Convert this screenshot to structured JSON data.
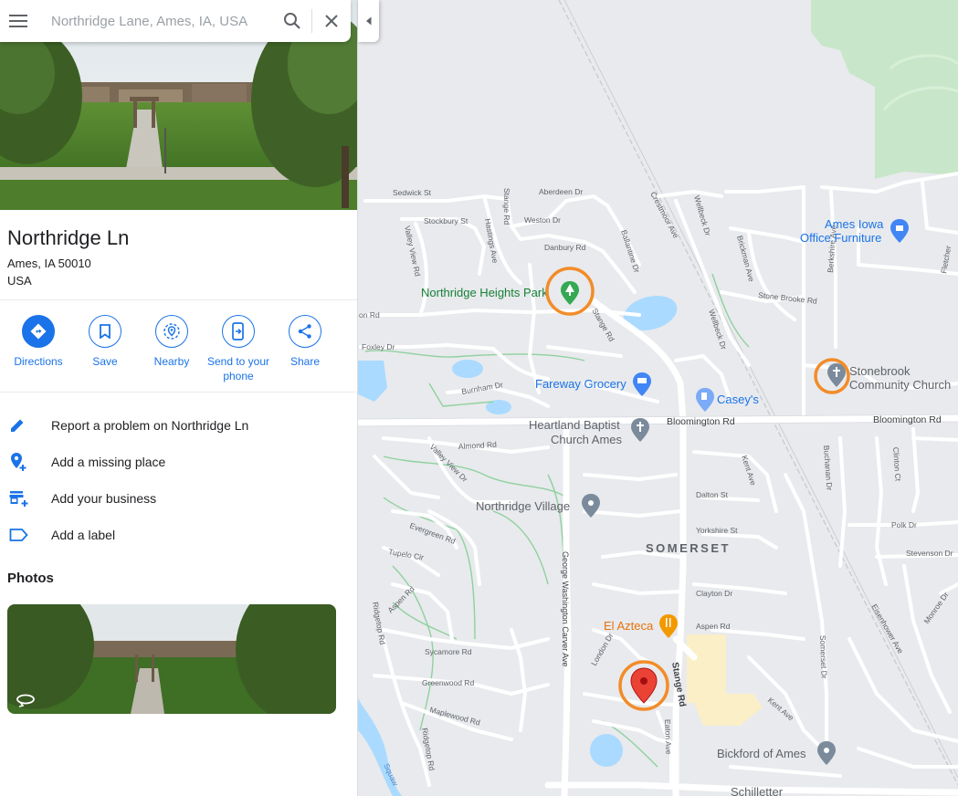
{
  "search": {
    "placeholder": "Northridge Lane, Ames, IA, USA"
  },
  "place": {
    "title": "Northridge Ln",
    "address_line1": "Ames, IA 50010",
    "address_line2": "USA"
  },
  "actions": [
    {
      "label": "Directions",
      "icon": "directions-icon"
    },
    {
      "label": "Save",
      "icon": "bookmark-icon"
    },
    {
      "label": "Nearby",
      "icon": "nearby-icon"
    },
    {
      "label_line1": "Send to your",
      "label_line2": "phone",
      "icon": "send-to-phone-icon"
    },
    {
      "label": "Share",
      "icon": "share-icon"
    }
  ],
  "menu": [
    {
      "label": "Report a problem on Northridge Ln",
      "icon": "pencil-icon"
    },
    {
      "label": "Add a missing place",
      "icon": "add-place-pin-icon"
    },
    {
      "label": "Add your business",
      "icon": "add-business-icon"
    },
    {
      "label": "Add a label",
      "icon": "label-tag-icon"
    }
  ],
  "photos": {
    "heading": "Photos"
  },
  "colors": {
    "accent": "#1a73e8",
    "map_bg": "#e8eaed",
    "park": "#c8e6c9",
    "water": "#aadaff",
    "highlight_circle": "#f28c28",
    "pin_red": "#ea4335",
    "commercial": "#fbefc7"
  },
  "map": {
    "places": {
      "ames_iowa_office_furniture_1": "Ames Iowa",
      "ames_iowa_office_furniture_2": "Office Furniture",
      "northridge_heights_park": "Northridge Heights Park",
      "fareway_grocery": "Fareway Grocery",
      "caseys": "Casey's",
      "heartland_baptist_1": "Heartland Baptist",
      "heartland_baptist_2": "Church Ames",
      "stonebrook_1": "Stonebrook",
      "stonebrook_2": "Community Church",
      "northridge_village": "Northridge Village",
      "somerset": "SOMERSET",
      "el_azteca": "El Azteca",
      "bickford": "Bickford of Ames",
      "schilletter": "Schilletter"
    },
    "streets": {
      "sedwick": "Sedwick St",
      "aberdeen": "Aberdeen Dr",
      "stockbury": "Stockbury St",
      "weston": "Weston Dr",
      "danbury": "Danbury Rd",
      "stange_top": "Stange Rd",
      "valley_view_rd": "Valley View Rd",
      "hastings": "Hastings Ave",
      "ballantine": "Ballantine Dr",
      "crestmoor": "Crestmoor Ave",
      "wellbeck": "Wellbeck Dr",
      "brickman": "Brickman Ave",
      "stone_brooke": "Stone Brooke Rd",
      "berkshire": "Berkshire Ave",
      "fletcher": "Fletcher",
      "on_rd": "on Rd",
      "foxley": "Foxley Dr",
      "stange_mid": "Stange Rd",
      "wellbeck2": "Wellbeck Dr",
      "burnham": "Burnham Dr",
      "bloomington1": "Bloomington Rd",
      "bloomington2": "Bloomington Rd",
      "almond": "Almond Rd",
      "valley_view_dr": "Valley View Dr",
      "kent_ave": "Kent Ave",
      "buchanan": "Buchanan Dr",
      "clinton": "Clinton Ct",
      "dalton": "Dalton St",
      "evergreen": "Evergreen Rd",
      "tupelo": "Tupelo Cir",
      "yorkshire": "Yorkshire St",
      "polk": "Polk Dr",
      "stevenson": "Stevenson Dr",
      "gw_carver": "George Washington Carver Ave",
      "clayton": "Clayton Dr",
      "aspen1": "Aspen Rd",
      "ridgetop1": "Ridgetop Rd",
      "aspen2": "Aspen Rd",
      "somerset_dr": "Somerset Dr",
      "eisenhower": "Eisenhower Ave",
      "monroe": "Monroe Dr",
      "sycamore": "Sycamore Rd",
      "london": "London Dr",
      "stange_bottom": "Stange Rd",
      "greenwood": "Greenwood Rd",
      "kent_ave2": "Kent Ave",
      "maplewood": "Maplewood Rd",
      "eaton": "Eaton Ave",
      "ridgetop2": "Ridgetop Rd",
      "squaw": "Squaw"
    }
  }
}
